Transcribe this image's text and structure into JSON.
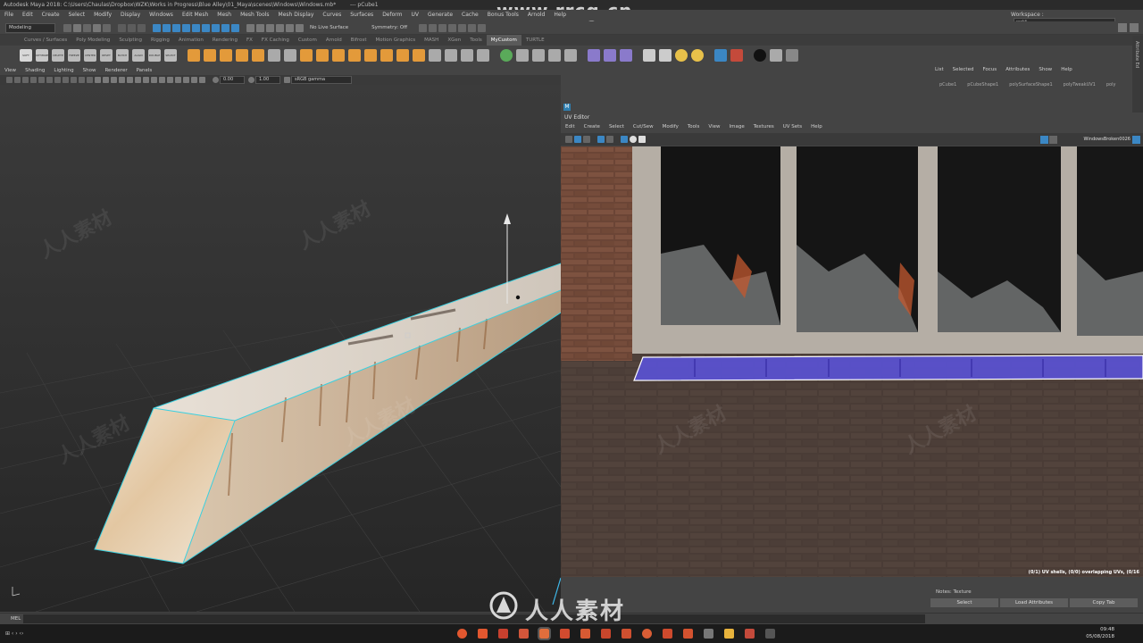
{
  "title_bar": {
    "text": "Autodesk Maya 2018: C:\\Users\\Chaulas\\Dropbox\\WZK\\Works in Progress\\Blue Alley\\01_Maya\\scenes\\Windows\\Windows.mb*",
    "object": "---  pCube1",
    "watermark": "www.rrcg.cn"
  },
  "menu": [
    "File",
    "Edit",
    "Create",
    "Select",
    "Modify",
    "Display",
    "Windows",
    "Edit Mesh",
    "Mesh",
    "Mesh Tools",
    "Mesh Display",
    "Curves",
    "Surfaces",
    "Deform",
    "UV",
    "Generate",
    "Cache",
    "Bonus Tools",
    "Arnold",
    "Help"
  ],
  "workspace": {
    "label": "Workspace :",
    "value": "wzk*"
  },
  "status_line": {
    "mode": "Modeling",
    "live_surface": "No Live Surface",
    "symmetry": "Symmetry: Off"
  },
  "shelf_tabs": [
    "Curves / Surfaces",
    "Poly Modeling",
    "Sculpting",
    "Rigging",
    "Animation",
    "Rendering",
    "FX",
    "FX Caching",
    "Custom",
    "Arnold",
    "Bifrost",
    "Motion Graphics",
    "MASH",
    "XGen",
    "Tools",
    "MyCustom",
    "TURTLE"
  ],
  "shelf_active": "MyCustom",
  "shelf_left_labels": [
    "SOFT",
    "OPTIMIZE",
    "DELETE HISTORY",
    "FREEZE TRANSFORM",
    "CENTER PIVOT",
    "RESET PIVOT",
    "MATCH PIVOT",
    "ALIGN OBJ",
    "DOUBLE SIDED",
    "SELECT EDGE"
  ],
  "viewport_menu": [
    "View",
    "Shading",
    "Lighting",
    "Show",
    "Renderer",
    "Panels"
  ],
  "viewport_toolbar": {
    "exposure": "0.00",
    "gamma": "1.00",
    "color_space": "sRGB gamma"
  },
  "right_panel": {
    "menu": [
      "List",
      "Selected",
      "Focus",
      "Attributes",
      "Show",
      "Help"
    ],
    "tabs": [
      "pCube1",
      "pCubeShape1",
      "polySurfaceShape1",
      "polyTweakUV1",
      "poly"
    ],
    "side_label": "Attribute Ed"
  },
  "uv_editor": {
    "title": "UV Editor",
    "menu": [
      "Edit",
      "Create",
      "Select",
      "Cut/Sew",
      "Modify",
      "Tools",
      "View",
      "Image",
      "Textures",
      "UV Sets",
      "Help"
    ],
    "texture_name": "WindowsBroken0026",
    "status": "(0/1) UV shells, (0/0) overlapping UVs, (0/16"
  },
  "attribute_editor": {
    "notes_label": "Notes:  Texture",
    "buttons": [
      "Select",
      "Load Attributes",
      "Copy Tab"
    ]
  },
  "command_line": {
    "label": "MEL"
  },
  "taskbar": {
    "time": "09:48",
    "date": "05/08/2018"
  },
  "bottom_watermark": "人人素材",
  "colors": {
    "uv_shell": "#5a52d6",
    "selection": "#3ad0e0",
    "accent": "#3b87c4"
  }
}
